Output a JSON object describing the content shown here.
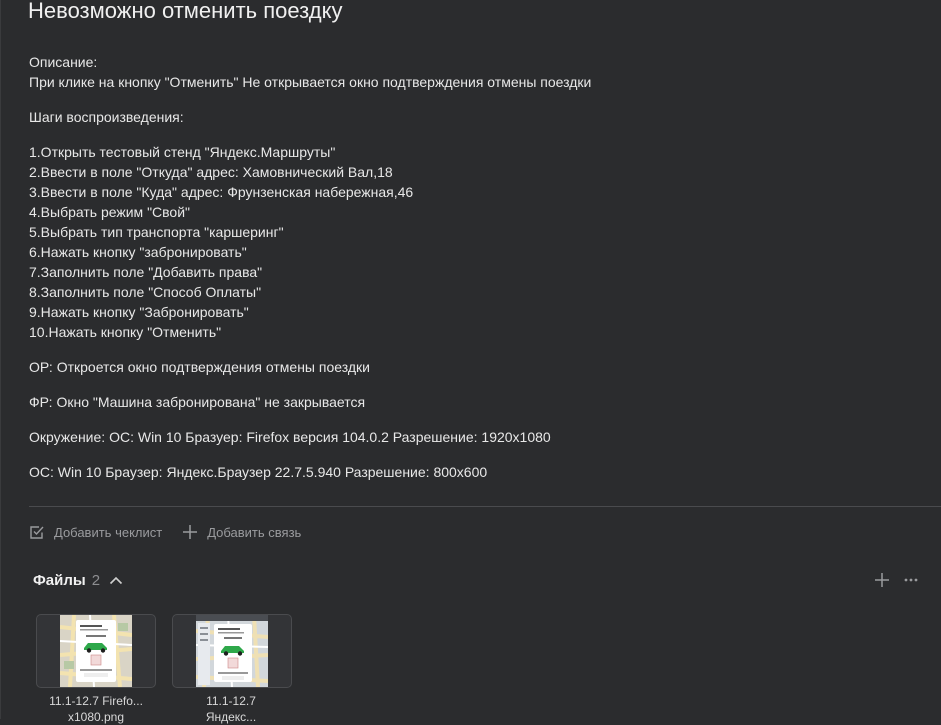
{
  "issue": {
    "title": "Невозможно отменить поездку"
  },
  "description": {
    "label": "Описание:",
    "text": "При клике на кнопку \"Отменить\" Не открывается окно подтверждения отмены поездки",
    "steps_label": "Шаги воспроизведения:",
    "steps": [
      "1.Открыть тестовый стенд \"Яндекс.Маршруты\"",
      "2.Ввести в поле \"Откуда\" адрес: Хамовнический Вал,18",
      "3.Ввести в поле \"Куда\" адрес: Фрунзенская набережная,46",
      "4.Выбрать режим \"Свой\"",
      "5.Выбрать тип транспорта \"каршеринг\"",
      "6.Нажать кнопку \"забронировать\"",
      "7.Заполнить поле \"Добавить права\"",
      "8.Заполнить поле \"Способ Оплаты\"",
      "9.Нажать кнопку \"Забронировать\"",
      "10.Нажать кнопку \"Отменить\""
    ],
    "expected": "ОР: Откроется окно подтверждения отмены поездки",
    "actual": "ФР: Окно \"Машина забронирована\" не закрывается",
    "environment_1": "Окружение: ОС: Win 10 Бразуер: Firefox версия 104.0.2 Разрешение: 1920x1080",
    "environment_2": "ОС: Win 10 Браузер: Яндекс.Браузер 22.7.5.940 Разрешение: 800x600"
  },
  "actions": {
    "add_checklist": "Добавить чеклист",
    "add_link": "Добавить связь"
  },
  "files": {
    "title": "Файлы",
    "count": "2",
    "items": [
      {
        "name_line1": "11.1-12.7 Firefo...",
        "name_line2": "x1080.png"
      },
      {
        "name_line1": "11.1-12.7",
        "name_line2": "Яндекс..."
      }
    ]
  },
  "colors": {
    "background": "#2b2c2e",
    "muted_text": "#9a9b9e",
    "car_green": "#2ea84a"
  }
}
